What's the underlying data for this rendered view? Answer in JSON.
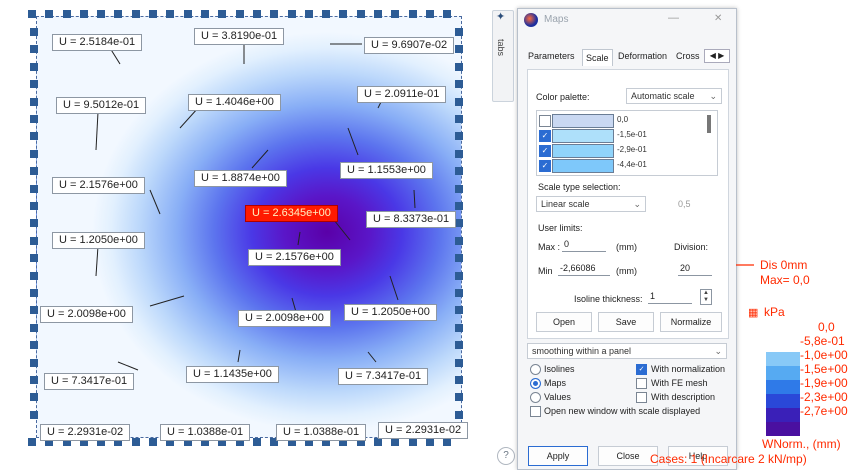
{
  "plot": {
    "labels": [
      {
        "text": "U = 2.5184e-01",
        "red": false
      },
      {
        "text": "U = 3.8190e-01",
        "red": false
      },
      {
        "text": "U = 9.6907e-02",
        "red": false
      },
      {
        "text": "U = 9.5012e-01",
        "red": false
      },
      {
        "text": "U = 1.4046e+00",
        "red": false
      },
      {
        "text": "U = 2.0911e-01",
        "red": false
      },
      {
        "text": "U = 1.8874e+00",
        "red": false
      },
      {
        "text": "U = 1.1553e+00",
        "red": false
      },
      {
        "text": "U = 2.1576e+00",
        "red": false
      },
      {
        "text": "U = 2.6345e+00",
        "red": true
      },
      {
        "text": "U = 8.3373e-01",
        "red": false
      },
      {
        "text": "U = 1.2050e+00",
        "red": false
      },
      {
        "text": "U = 2.1576e+00",
        "red": false
      },
      {
        "text": "U = 2.0098e+00",
        "red": false
      },
      {
        "text": "U = 2.0098e+00",
        "red": false
      },
      {
        "text": "U = 1.2050e+00",
        "red": false
      },
      {
        "text": "U = 7.3417e-01",
        "red": false
      },
      {
        "text": "U = 1.1435e+00",
        "red": false
      },
      {
        "text": "U = 7.3417e-01",
        "red": false
      },
      {
        "text": "U = 2.2931e-02",
        "red": false
      },
      {
        "text": "U = 1.0388e-01",
        "red": false
      },
      {
        "text": "U = 1.0388e-01",
        "red": false
      },
      {
        "text": "U = 2.2931e-02",
        "red": false
      }
    ]
  },
  "side_tab": {
    "label": "tabs"
  },
  "dialog": {
    "title": "Maps",
    "tabs": [
      "Parameters",
      "Scale",
      "Deformation",
      "Cross"
    ],
    "active_tab": "Scale",
    "color_palette_label": "Color palette:",
    "color_palette_value": "Automatic scale",
    "palette_rows": [
      {
        "checked": false,
        "value": "0,0",
        "color": "#c9d8f2"
      },
      {
        "checked": true,
        "value": "-1,5e-01",
        "color": "#aee0fa"
      },
      {
        "checked": true,
        "value": "-2,9e-01",
        "color": "#90d4fb"
      },
      {
        "checked": true,
        "value": "-4,4e-01",
        "color": "#7ec8fa"
      }
    ],
    "scale_type_label": "Scale type selection:",
    "scale_type_value": "Linear scale",
    "scale_factor": "0,5",
    "user_limits_label": "User limits:",
    "max_label": "Max :",
    "max_value": "0",
    "max_unit": "(mm)",
    "division_label": "Division:",
    "min_label": "Min",
    "min_value": "-2,66086",
    "min_unit": "(mm)",
    "division_value": "20",
    "isoline_label": "Isoline thickness:",
    "isoline_value": "1",
    "buttons": {
      "open": "Open",
      "save": "Save",
      "normalize": "Normalize"
    },
    "smoothing_value": "smoothing within a panel",
    "radios": [
      {
        "label": "Isolines",
        "selected": false
      },
      {
        "label": "Maps",
        "selected": true
      },
      {
        "label": "Values",
        "selected": false
      }
    ],
    "checks": [
      {
        "label": "With normalization",
        "checked": true
      },
      {
        "label": "With FE mesh",
        "checked": false
      },
      {
        "label": "With description",
        "checked": false
      }
    ],
    "open_new_window": {
      "label": "Open new window with scale displayed",
      "checked": false
    },
    "footer": {
      "apply": "Apply",
      "close": "Close",
      "help": "Help"
    }
  },
  "legend": {
    "dis_line1": "Dis  0mm",
    "dis_line2": "Max=     0,0",
    "unit": "kPa",
    "entries": [
      {
        "value": "0,0",
        "color": "#ffffff"
      },
      {
        "value": "-5,8e-01",
        "color": "#88c9f7"
      },
      {
        "value": "-1,0e+00",
        "color": "#56aaf2"
      },
      {
        "value": "-1,5e+00",
        "color": "#2f7ae8"
      },
      {
        "value": "-1,9e+00",
        "color": "#2a48d8"
      },
      {
        "value": "-2,3e+00",
        "color": "#3a20b8"
      },
      {
        "value": "-2,7e+00",
        "color": "#4a10a0"
      }
    ],
    "norm_label": "WNorm., (mm)",
    "cases_label": "Cases: 1 (Incarcare 2 kN/mp)"
  },
  "colors": {
    "accent": "#2b6cd2",
    "legend_text": "#ff2a00",
    "highlight": "#ff1a00"
  }
}
